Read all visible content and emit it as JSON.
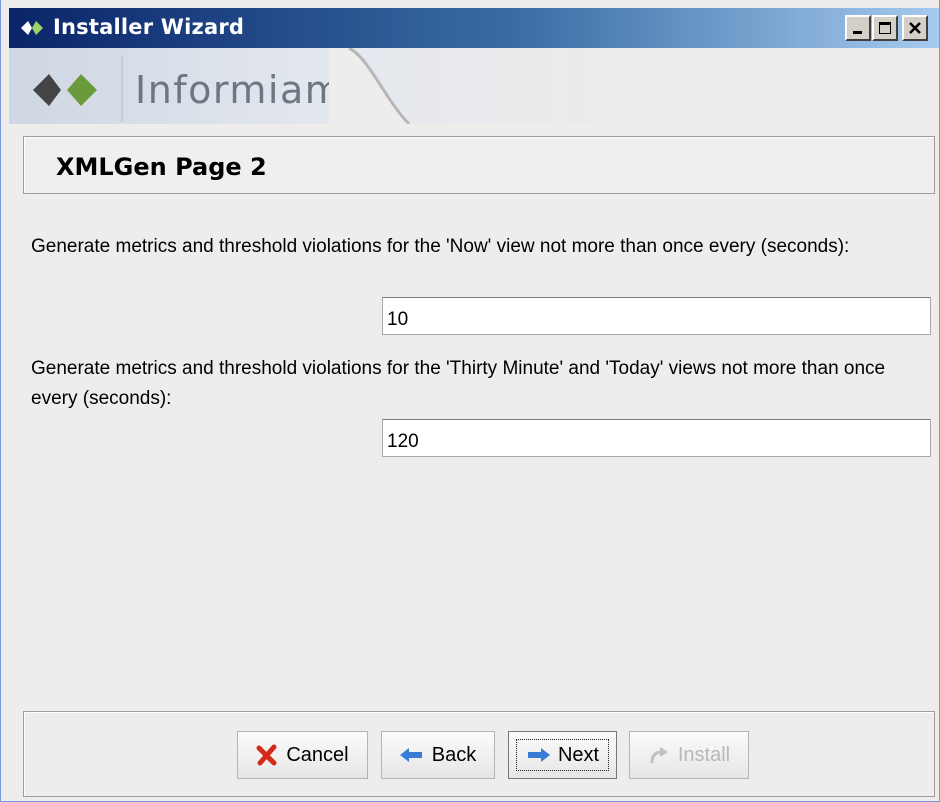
{
  "window": {
    "title": "Installer Wizard",
    "controls": {
      "minimize": "minimize",
      "maximize": "maximize",
      "close": "close"
    }
  },
  "banner": {
    "logo_text": "Informiam"
  },
  "page": {
    "title": "XMLGen Page 2",
    "fields": [
      {
        "label": "Generate metrics and threshold violations for the 'Now' view not more than once every (seconds):",
        "value": "10"
      },
      {
        "label": "Generate metrics and threshold violations for the 'Thirty Minute' and 'Today' views not more than once every (seconds):",
        "value": "120"
      }
    ]
  },
  "buttons": {
    "cancel": "Cancel",
    "back": "Back",
    "next": "Next",
    "install": "Install"
  },
  "icons": {
    "app": "diamond-logo-icon",
    "cancel": "red-x-icon",
    "back": "left-arrow-icon",
    "next": "right-arrow-icon",
    "install": "curved-arrow-icon"
  },
  "colors": {
    "titlebar_start": "#0a246a",
    "titlebar_end": "#a6caf0",
    "logo_dark": "#444444",
    "logo_green": "#6a9a3c",
    "cancel_red": "#d42a1a",
    "arrow_blue": "#3a7bd5"
  }
}
